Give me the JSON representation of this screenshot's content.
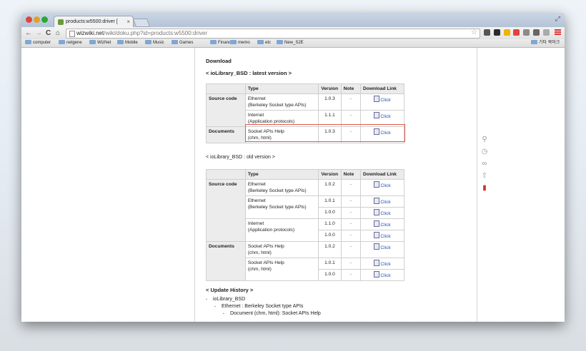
{
  "browser": {
    "tab_title": "products:w5500:driver [",
    "tab_close": "×",
    "resize_glyph": "⤢",
    "url_host": "wizwiki.net",
    "url_path": "/wiki/doku.php?id=products:w5500:driver",
    "nav": {
      "back": "←",
      "forward": "→",
      "reload": "C",
      "home": "⌂"
    },
    "bookmark_star": "☆",
    "bookmarks": [
      "computer",
      "netgene",
      "WizNet",
      "Mobile",
      "Music",
      "Games",
      "Finance",
      "memo",
      "etc",
      "New_S2E"
    ],
    "other_bookmarks": "기타 북마크"
  },
  "page": {
    "heading": "Download",
    "latest_title": "< ioLibrary_BSD : latest version >",
    "old_title": "< ioLibrary_BSD : old version >",
    "history_title": "< Update History >",
    "headers": [
      "Type",
      "Version",
      "Note",
      "Download Link"
    ],
    "latest_rows": [
      {
        "group": "Source code",
        "type1": "Ethernet",
        "type2": "(Berkeley Socket type APIs)",
        "version": "1.0.3",
        "note": "-",
        "link": "Click"
      },
      {
        "group": "",
        "type1": "Internet",
        "type2": "(Application protocols)",
        "version": "1.1.1",
        "note": "-",
        "link": "Click"
      },
      {
        "group": "Documents",
        "type1": "Socket APIs Help",
        "type2": "(chm, html)",
        "version": "1.0.3",
        "note": "-",
        "link": "Click"
      }
    ],
    "old_groups": {
      "source": "Source code",
      "docs": "Documents"
    },
    "old_types": [
      {
        "t1": "Ethernet",
        "t2": "(Berkeley Socket type APIs)"
      },
      {
        "t1": "Ethernet",
        "t2": "(Berkeley Socket type APIs)"
      },
      {
        "t1": "Internet",
        "t2": "(Application protocols)"
      },
      {
        "t1": "Socket APIs Help",
        "t2": "(chm, html)"
      },
      {
        "t1": "Socket APIs Help",
        "t2": "(chm, html)"
      }
    ],
    "old_rows": [
      {
        "version": "1.0.2",
        "note": "-",
        "link": "Click"
      },
      {
        "version": "1.0.1",
        "note": "-",
        "link": "Click"
      },
      {
        "version": "1.0.0",
        "note": "-",
        "link": "Click"
      },
      {
        "version": "1.1.0",
        "note": "-",
        "link": "Click"
      },
      {
        "version": "1.0.0",
        "note": "-",
        "link": "Click"
      },
      {
        "version": "1.0.2",
        "note": "-",
        "link": "Click"
      },
      {
        "version": "1.0.1",
        "note": "-",
        "link": "Click"
      },
      {
        "version": "1.0.0",
        "note": "-",
        "link": "Click"
      }
    ],
    "history": [
      "ioLibrary_BSD",
      "Ethernet : Berkeley Socket type APIs",
      "Document (chm, html): Socket APIs Help"
    ]
  },
  "right_tools": [
    "search-icon",
    "history-icon",
    "backlinks-icon",
    "back-to-top-icon",
    "export-pdf-icon"
  ],
  "colors": {
    "highlight": "#e05a4c",
    "link": "#2050b0",
    "header_bg": "#ebebeb"
  }
}
